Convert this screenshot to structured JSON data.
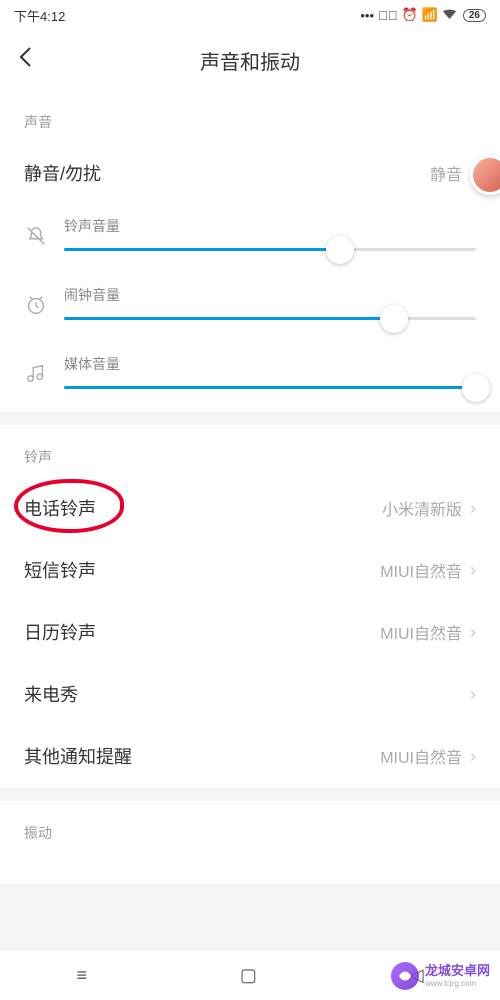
{
  "status": {
    "time": "下午4:12",
    "battery": "26"
  },
  "header": {
    "title": "声音和振动"
  },
  "sections": {
    "sound": {
      "header": "声音",
      "mute_row": {
        "label": "静音/勿扰",
        "value": "静音"
      },
      "sliders": {
        "ring": {
          "label": "铃声音量",
          "percent": 67
        },
        "alarm": {
          "label": "闹钟音量",
          "percent": 80
        },
        "media": {
          "label": "媒体音量",
          "percent": 100
        }
      }
    },
    "ringtone": {
      "header": "铃声",
      "rows": [
        {
          "label": "电话铃声",
          "value": "小米清新版",
          "highlighted": true
        },
        {
          "label": "短信铃声",
          "value": "MIUI自然音"
        },
        {
          "label": "日历铃声",
          "value": "MIUI自然音"
        },
        {
          "label": "来电秀",
          "value": ""
        },
        {
          "label": "其他通知提醒",
          "value": "MIUI自然音"
        }
      ]
    },
    "vibration": {
      "header": "振动"
    }
  },
  "watermark": {
    "title": "龙城安卓网",
    "sub": "www.lcjrg.com"
  }
}
